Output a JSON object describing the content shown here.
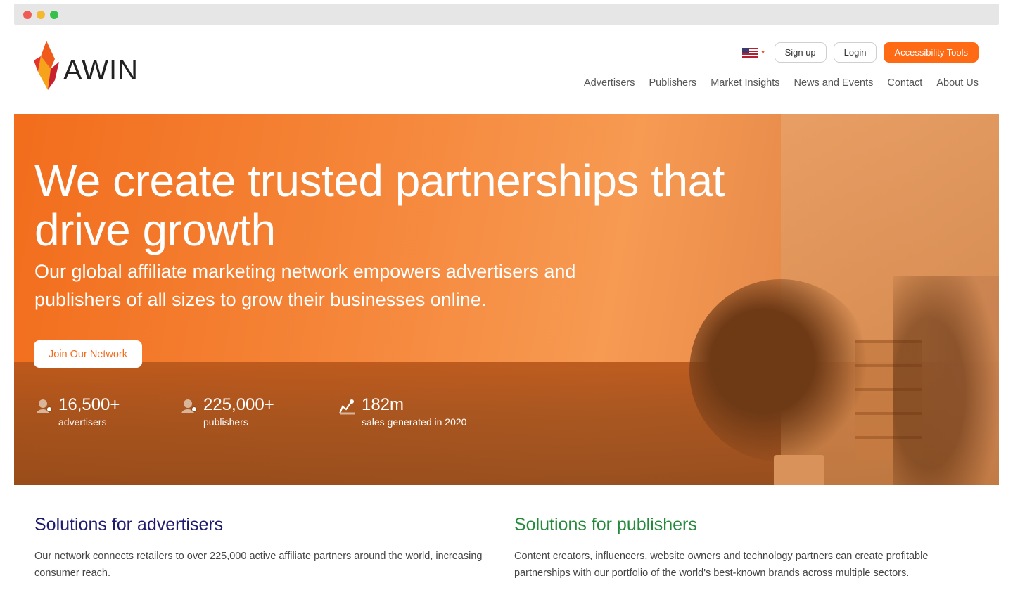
{
  "window": {
    "controls": [
      "close",
      "minimize",
      "maximize"
    ]
  },
  "header": {
    "logo_text": "AWIN",
    "locale_icon": "us-flag-icon",
    "sign_up": "Sign up",
    "login": "Login",
    "accessibility": "Accessibility Tools",
    "nav": [
      "Advertisers",
      "Publishers",
      "Market Insights",
      "News and Events",
      "Contact",
      "About Us"
    ]
  },
  "hero": {
    "title": "We create trusted partnerships that drive growth",
    "subtitle": "Our global affiliate marketing network empowers advertisers and publishers of all sizes to grow their businesses online.",
    "cta": "Join Our Network",
    "stats": [
      {
        "value": "16,500+",
        "label": "advertisers",
        "icon": "advertiser-icon"
      },
      {
        "value": "225,000+",
        "label": "publishers",
        "icon": "publisher-icon"
      },
      {
        "value": "182m",
        "label": "sales generated in 2020",
        "icon": "sales-chart-icon"
      }
    ]
  },
  "solutions": {
    "advertisers": {
      "title": "Solutions for advertisers",
      "text": "Our network connects retailers to over 225,000 active affiliate partners around the world, increasing consumer reach."
    },
    "publishers": {
      "title": "Solutions for publishers",
      "text": "Content creators, influencers, website owners and technology partners can create profitable partnerships with our portfolio of the world's best-known brands across multiple sectors."
    }
  },
  "colors": {
    "accent": "#ff6a14",
    "advertisers_heading": "#1e1b6e",
    "publishers_heading": "#24893a"
  }
}
